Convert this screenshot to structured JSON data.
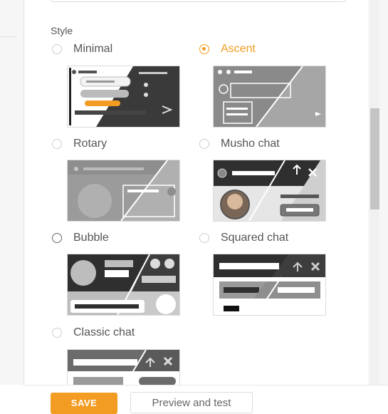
{
  "style_section": {
    "label": "Style",
    "selected": "Ascent",
    "accent_color": "#f39c23",
    "options": [
      {
        "label": "Minimal",
        "checked": false,
        "preview_icon": "minimal-preview"
      },
      {
        "label": "Ascent",
        "checked": true,
        "preview_icon": "ascent-preview"
      },
      {
        "label": "Rotary",
        "checked": false,
        "preview_icon": "rotary-preview"
      },
      {
        "label": "Musho chat",
        "checked": false,
        "preview_icon": "musho-chat-preview"
      },
      {
        "label": "Bubble",
        "checked": false,
        "preview_icon": "bubble-preview"
      },
      {
        "label": "Squared chat",
        "checked": false,
        "preview_icon": "squared-chat-preview"
      },
      {
        "label": "Classic chat",
        "checked": false,
        "preview_icon": "classic-chat-preview"
      }
    ]
  },
  "footer": {
    "save_label": "SAVE",
    "preview_label": "Preview and test"
  }
}
